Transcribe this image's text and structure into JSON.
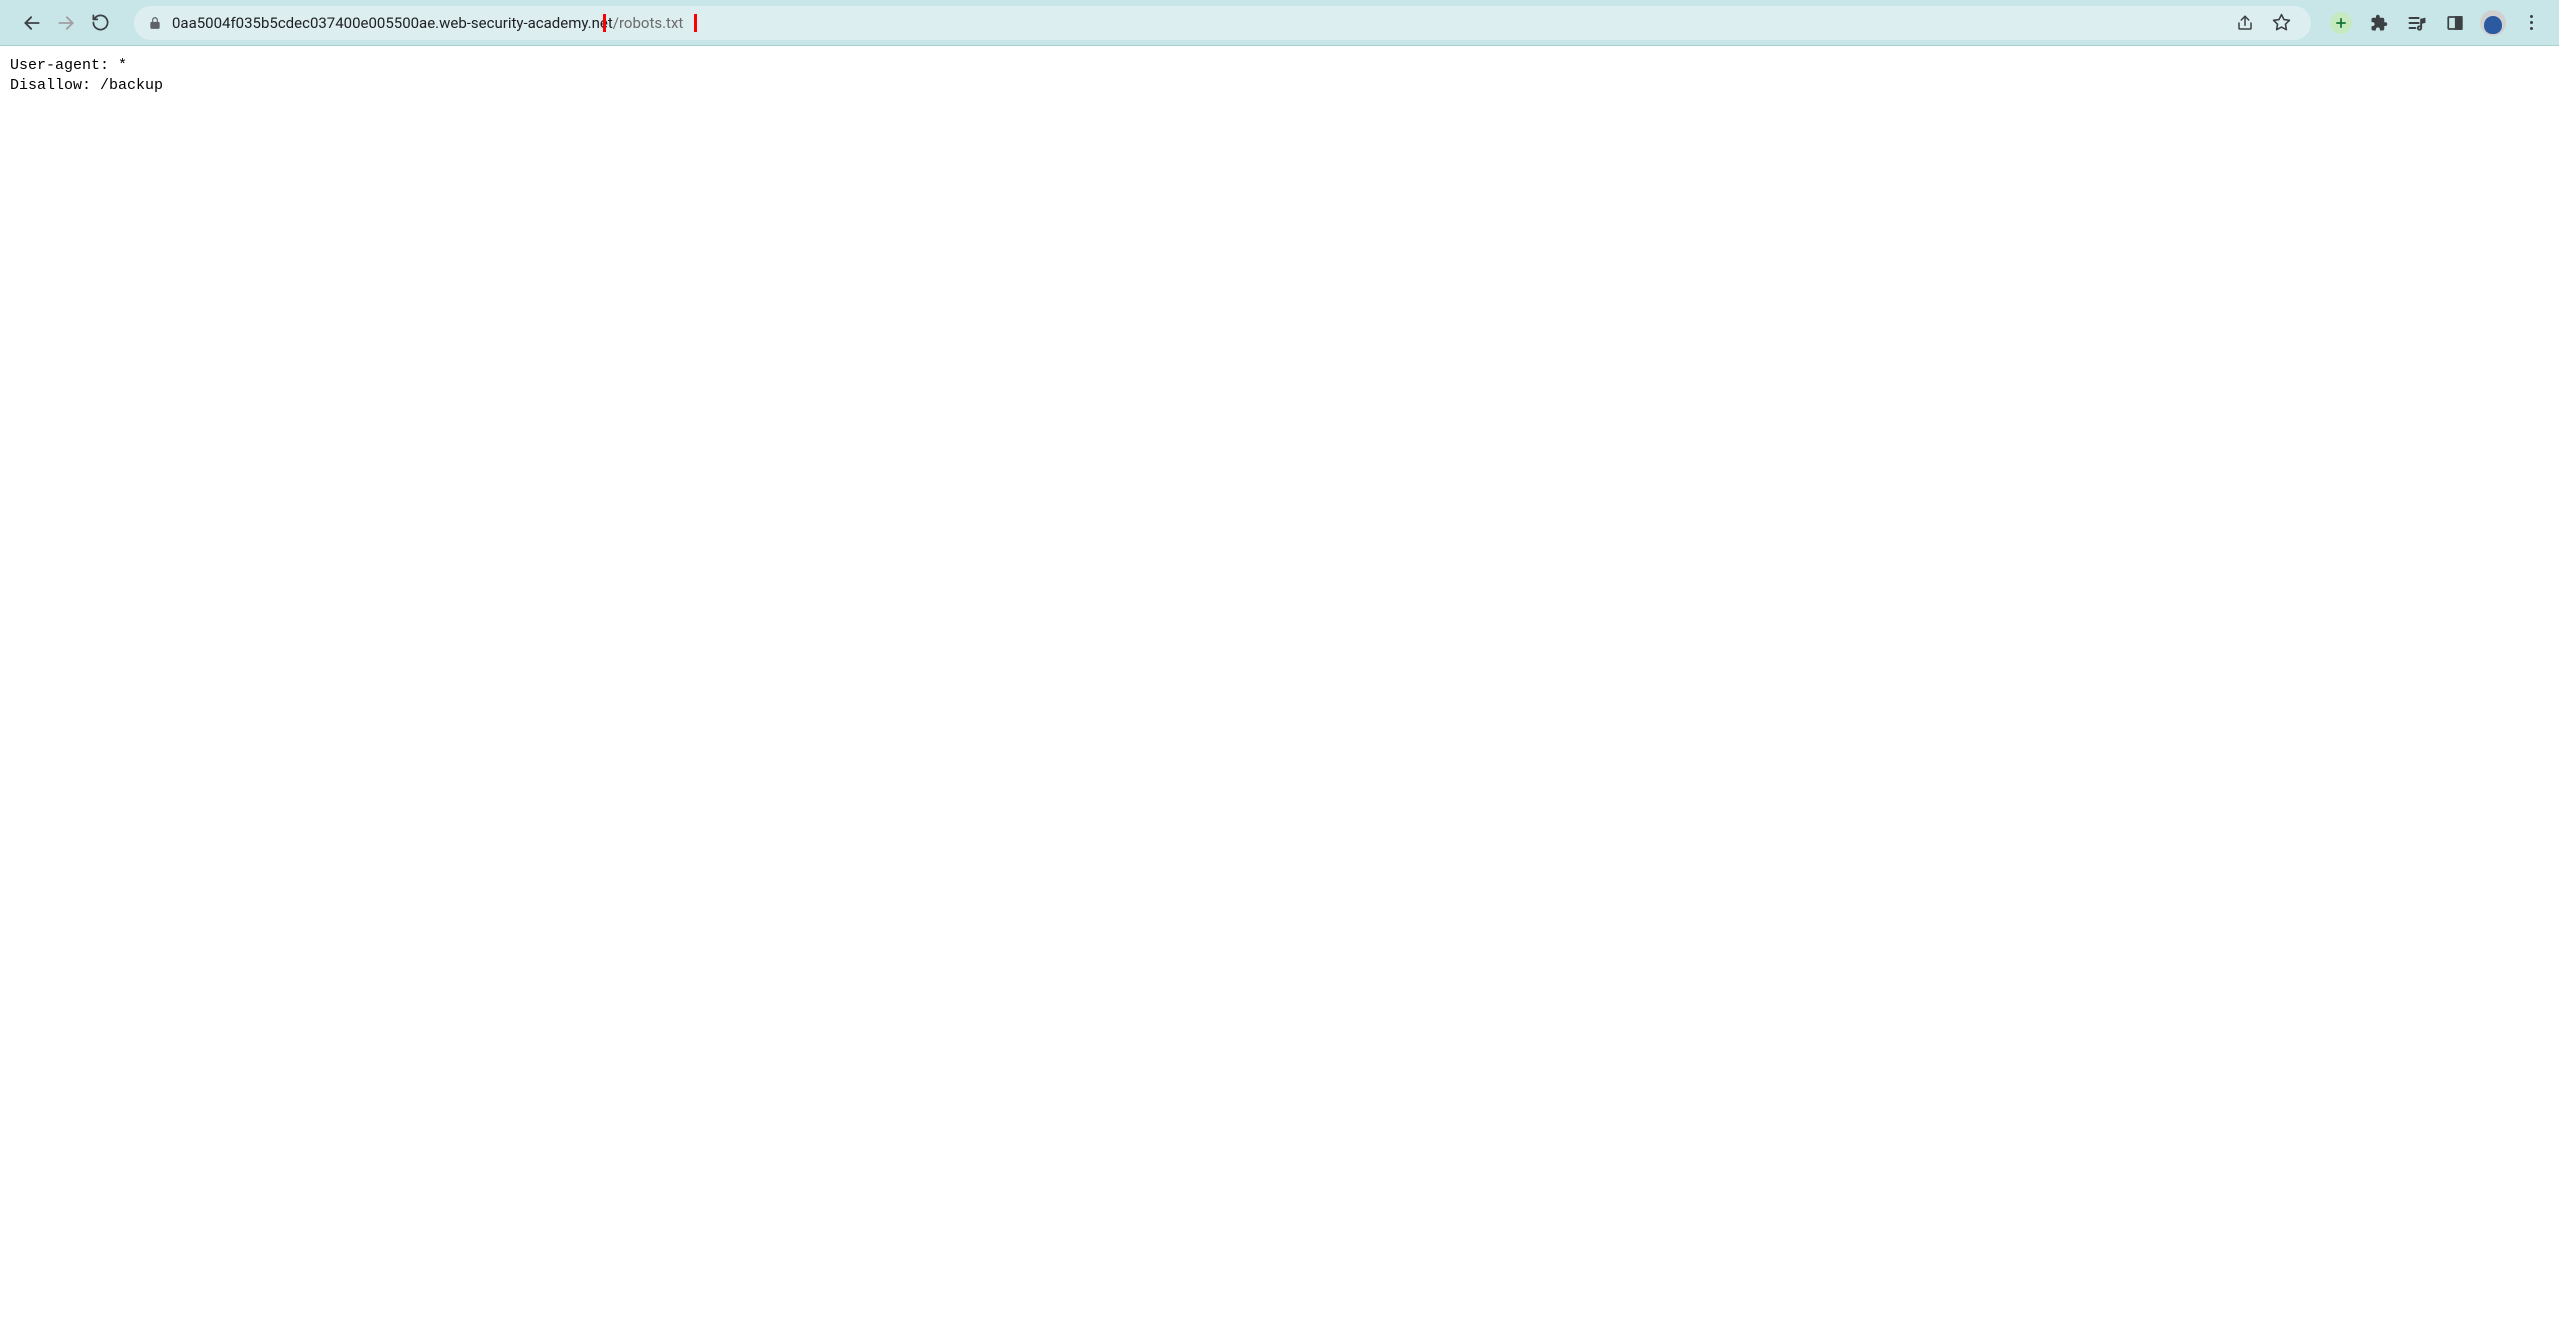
{
  "toolbar": {
    "url_domain": "0aa5004f035b5cdec037400e005500ae.web-security-academy.net",
    "url_path": "/robots.txt"
  },
  "page": {
    "content": "User-agent: *\nDisallow: /backup"
  },
  "icons": {
    "back": "back-icon",
    "forward": "forward-icon",
    "reload": "reload-icon",
    "lock": "lock-icon",
    "share": "share-icon",
    "bookmark": "bookmark-icon",
    "plus": "plus-icon",
    "extension": "extension-icon",
    "playlist": "playlist-icon",
    "panel": "panel-icon",
    "avatar": "avatar-icon",
    "menu": "menu-icon"
  }
}
